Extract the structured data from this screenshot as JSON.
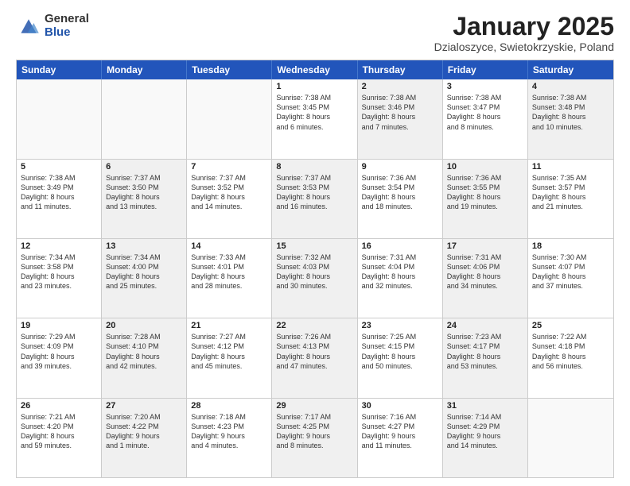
{
  "logo": {
    "general": "General",
    "blue": "Blue"
  },
  "header": {
    "month": "January 2025",
    "location": "Dzialoszyce, Swietokrzyskie, Poland"
  },
  "weekdays": [
    "Sunday",
    "Monday",
    "Tuesday",
    "Wednesday",
    "Thursday",
    "Friday",
    "Saturday"
  ],
  "rows": [
    [
      {
        "day": "",
        "info": "",
        "shaded": false,
        "empty": true
      },
      {
        "day": "",
        "info": "",
        "shaded": false,
        "empty": true
      },
      {
        "day": "",
        "info": "",
        "shaded": false,
        "empty": true
      },
      {
        "day": "1",
        "info": "Sunrise: 7:38 AM\nSunset: 3:45 PM\nDaylight: 8 hours\nand 6 minutes.",
        "shaded": false,
        "empty": false
      },
      {
        "day": "2",
        "info": "Sunrise: 7:38 AM\nSunset: 3:46 PM\nDaylight: 8 hours\nand 7 minutes.",
        "shaded": true,
        "empty": false
      },
      {
        "day": "3",
        "info": "Sunrise: 7:38 AM\nSunset: 3:47 PM\nDaylight: 8 hours\nand 8 minutes.",
        "shaded": false,
        "empty": false
      },
      {
        "day": "4",
        "info": "Sunrise: 7:38 AM\nSunset: 3:48 PM\nDaylight: 8 hours\nand 10 minutes.",
        "shaded": true,
        "empty": false
      }
    ],
    [
      {
        "day": "5",
        "info": "Sunrise: 7:38 AM\nSunset: 3:49 PM\nDaylight: 8 hours\nand 11 minutes.",
        "shaded": false,
        "empty": false
      },
      {
        "day": "6",
        "info": "Sunrise: 7:37 AM\nSunset: 3:50 PM\nDaylight: 8 hours\nand 13 minutes.",
        "shaded": true,
        "empty": false
      },
      {
        "day": "7",
        "info": "Sunrise: 7:37 AM\nSunset: 3:52 PM\nDaylight: 8 hours\nand 14 minutes.",
        "shaded": false,
        "empty": false
      },
      {
        "day": "8",
        "info": "Sunrise: 7:37 AM\nSunset: 3:53 PM\nDaylight: 8 hours\nand 16 minutes.",
        "shaded": true,
        "empty": false
      },
      {
        "day": "9",
        "info": "Sunrise: 7:36 AM\nSunset: 3:54 PM\nDaylight: 8 hours\nand 18 minutes.",
        "shaded": false,
        "empty": false
      },
      {
        "day": "10",
        "info": "Sunrise: 7:36 AM\nSunset: 3:55 PM\nDaylight: 8 hours\nand 19 minutes.",
        "shaded": true,
        "empty": false
      },
      {
        "day": "11",
        "info": "Sunrise: 7:35 AM\nSunset: 3:57 PM\nDaylight: 8 hours\nand 21 minutes.",
        "shaded": false,
        "empty": false
      }
    ],
    [
      {
        "day": "12",
        "info": "Sunrise: 7:34 AM\nSunset: 3:58 PM\nDaylight: 8 hours\nand 23 minutes.",
        "shaded": false,
        "empty": false
      },
      {
        "day": "13",
        "info": "Sunrise: 7:34 AM\nSunset: 4:00 PM\nDaylight: 8 hours\nand 25 minutes.",
        "shaded": true,
        "empty": false
      },
      {
        "day": "14",
        "info": "Sunrise: 7:33 AM\nSunset: 4:01 PM\nDaylight: 8 hours\nand 28 minutes.",
        "shaded": false,
        "empty": false
      },
      {
        "day": "15",
        "info": "Sunrise: 7:32 AM\nSunset: 4:03 PM\nDaylight: 8 hours\nand 30 minutes.",
        "shaded": true,
        "empty": false
      },
      {
        "day": "16",
        "info": "Sunrise: 7:31 AM\nSunset: 4:04 PM\nDaylight: 8 hours\nand 32 minutes.",
        "shaded": false,
        "empty": false
      },
      {
        "day": "17",
        "info": "Sunrise: 7:31 AM\nSunset: 4:06 PM\nDaylight: 8 hours\nand 34 minutes.",
        "shaded": true,
        "empty": false
      },
      {
        "day": "18",
        "info": "Sunrise: 7:30 AM\nSunset: 4:07 PM\nDaylight: 8 hours\nand 37 minutes.",
        "shaded": false,
        "empty": false
      }
    ],
    [
      {
        "day": "19",
        "info": "Sunrise: 7:29 AM\nSunset: 4:09 PM\nDaylight: 8 hours\nand 39 minutes.",
        "shaded": false,
        "empty": false
      },
      {
        "day": "20",
        "info": "Sunrise: 7:28 AM\nSunset: 4:10 PM\nDaylight: 8 hours\nand 42 minutes.",
        "shaded": true,
        "empty": false
      },
      {
        "day": "21",
        "info": "Sunrise: 7:27 AM\nSunset: 4:12 PM\nDaylight: 8 hours\nand 45 minutes.",
        "shaded": false,
        "empty": false
      },
      {
        "day": "22",
        "info": "Sunrise: 7:26 AM\nSunset: 4:13 PM\nDaylight: 8 hours\nand 47 minutes.",
        "shaded": true,
        "empty": false
      },
      {
        "day": "23",
        "info": "Sunrise: 7:25 AM\nSunset: 4:15 PM\nDaylight: 8 hours\nand 50 minutes.",
        "shaded": false,
        "empty": false
      },
      {
        "day": "24",
        "info": "Sunrise: 7:23 AM\nSunset: 4:17 PM\nDaylight: 8 hours\nand 53 minutes.",
        "shaded": true,
        "empty": false
      },
      {
        "day": "25",
        "info": "Sunrise: 7:22 AM\nSunset: 4:18 PM\nDaylight: 8 hours\nand 56 minutes.",
        "shaded": false,
        "empty": false
      }
    ],
    [
      {
        "day": "26",
        "info": "Sunrise: 7:21 AM\nSunset: 4:20 PM\nDaylight: 8 hours\nand 59 minutes.",
        "shaded": false,
        "empty": false
      },
      {
        "day": "27",
        "info": "Sunrise: 7:20 AM\nSunset: 4:22 PM\nDaylight: 9 hours\nand 1 minute.",
        "shaded": true,
        "empty": false
      },
      {
        "day": "28",
        "info": "Sunrise: 7:18 AM\nSunset: 4:23 PM\nDaylight: 9 hours\nand 4 minutes.",
        "shaded": false,
        "empty": false
      },
      {
        "day": "29",
        "info": "Sunrise: 7:17 AM\nSunset: 4:25 PM\nDaylight: 9 hours\nand 8 minutes.",
        "shaded": true,
        "empty": false
      },
      {
        "day": "30",
        "info": "Sunrise: 7:16 AM\nSunset: 4:27 PM\nDaylight: 9 hours\nand 11 minutes.",
        "shaded": false,
        "empty": false
      },
      {
        "day": "31",
        "info": "Sunrise: 7:14 AM\nSunset: 4:29 PM\nDaylight: 9 hours\nand 14 minutes.",
        "shaded": true,
        "empty": false
      },
      {
        "day": "",
        "info": "",
        "shaded": false,
        "empty": true
      }
    ]
  ]
}
